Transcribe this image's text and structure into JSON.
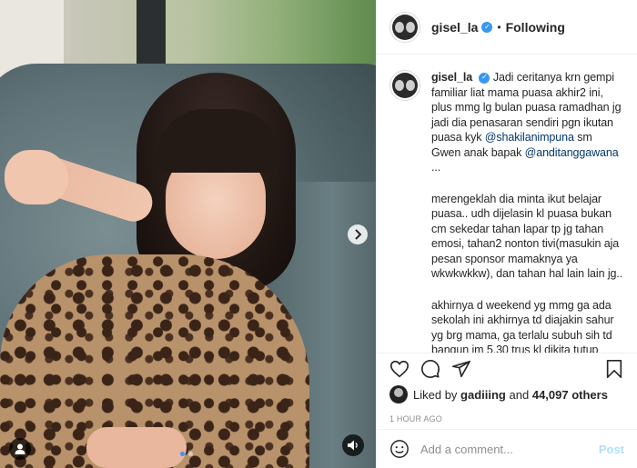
{
  "post": {
    "username": "gisel_la",
    "follow_status": "Following",
    "separator": "•",
    "caption_paragraphs": [
      {
        "parts": [
          {
            "text": "Jadi ceritanya krn gempi familiar liat mama puasa akhir2 ini, plus mmg lg bulan puasa ramadhan jg jadi dia penasaran sendiri pgn ikutan puasa kyk ",
            "type": "text"
          },
          {
            "text": "@shakilanimpuna",
            "type": "mention"
          },
          {
            "text": " sm Gwen anak bapak ",
            "type": "text"
          },
          {
            "text": "@anditanggawana",
            "type": "mention"
          },
          {
            "text": " ...",
            "type": "text"
          }
        ]
      },
      {
        "parts": [
          {
            "text": "merengeklah dia minta ikut belajar puasa.. udh dijelasin kl puasa bukan cm sekedar tahan lapar tp jg tahan emosi, tahan2 nonton tivi(masukin aja pesan sponsor mamaknya ya wkwkwkkw), dan tahan hal lain lain jg..",
            "type": "text"
          }
        ]
      },
      {
        "parts": [
          {
            "text": "akhirnya d weekend yg mmg ga ada sekolah ini akhirnya td diajakin sahur yg brg mama, ga terlalu subuh sih td bangun jm 5.30 trus kl dikita tutup",
            "type": "text"
          }
        ]
      }
    ],
    "likes": {
      "prefix": "Liked by",
      "liker": "gadiiing",
      "joiner": "and",
      "others": "44,097 others"
    },
    "timestamp": "1 HOUR AGO",
    "comment": {
      "placeholder": "Add a comment...",
      "post_label": "Post"
    },
    "carousel": {
      "slides": 2,
      "active": 1
    }
  },
  "colors": {
    "verified": "#3897f0",
    "mention": "#00376b",
    "post_disabled": "#b2dffc",
    "timestamp": "#8e8e8e"
  }
}
